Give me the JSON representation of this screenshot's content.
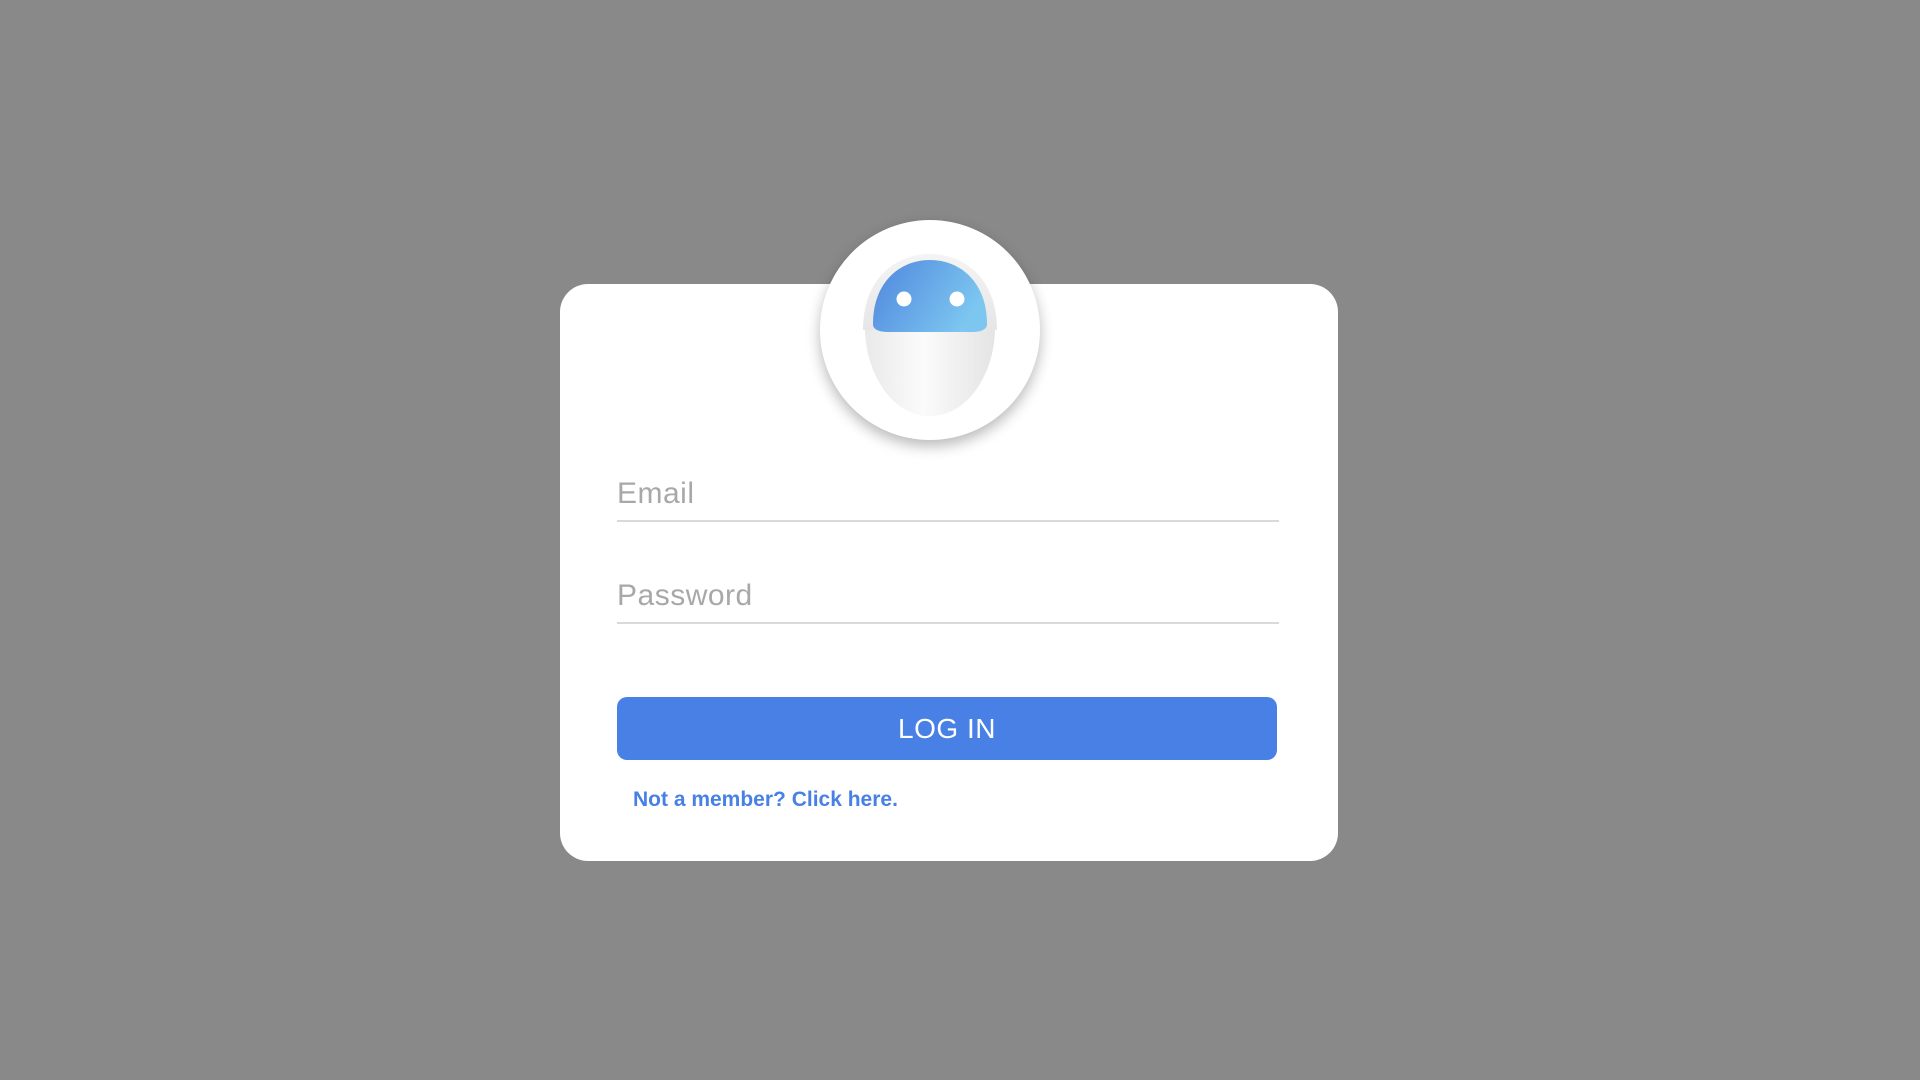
{
  "login_form": {
    "email_placeholder": "Email",
    "password_placeholder": "Password",
    "submit_label": "LOG IN",
    "signup_link": "Not a member? Click here."
  },
  "avatar": {
    "icon": "robot-icon"
  },
  "colors": {
    "background": "#898989",
    "card": "#ffffff",
    "accent": "#4880e6",
    "placeholder": "#a8a8a8",
    "underline": "#d9d9d9",
    "robot_head_start": "#4f86dd",
    "robot_head_end": "#7cc6f0"
  }
}
